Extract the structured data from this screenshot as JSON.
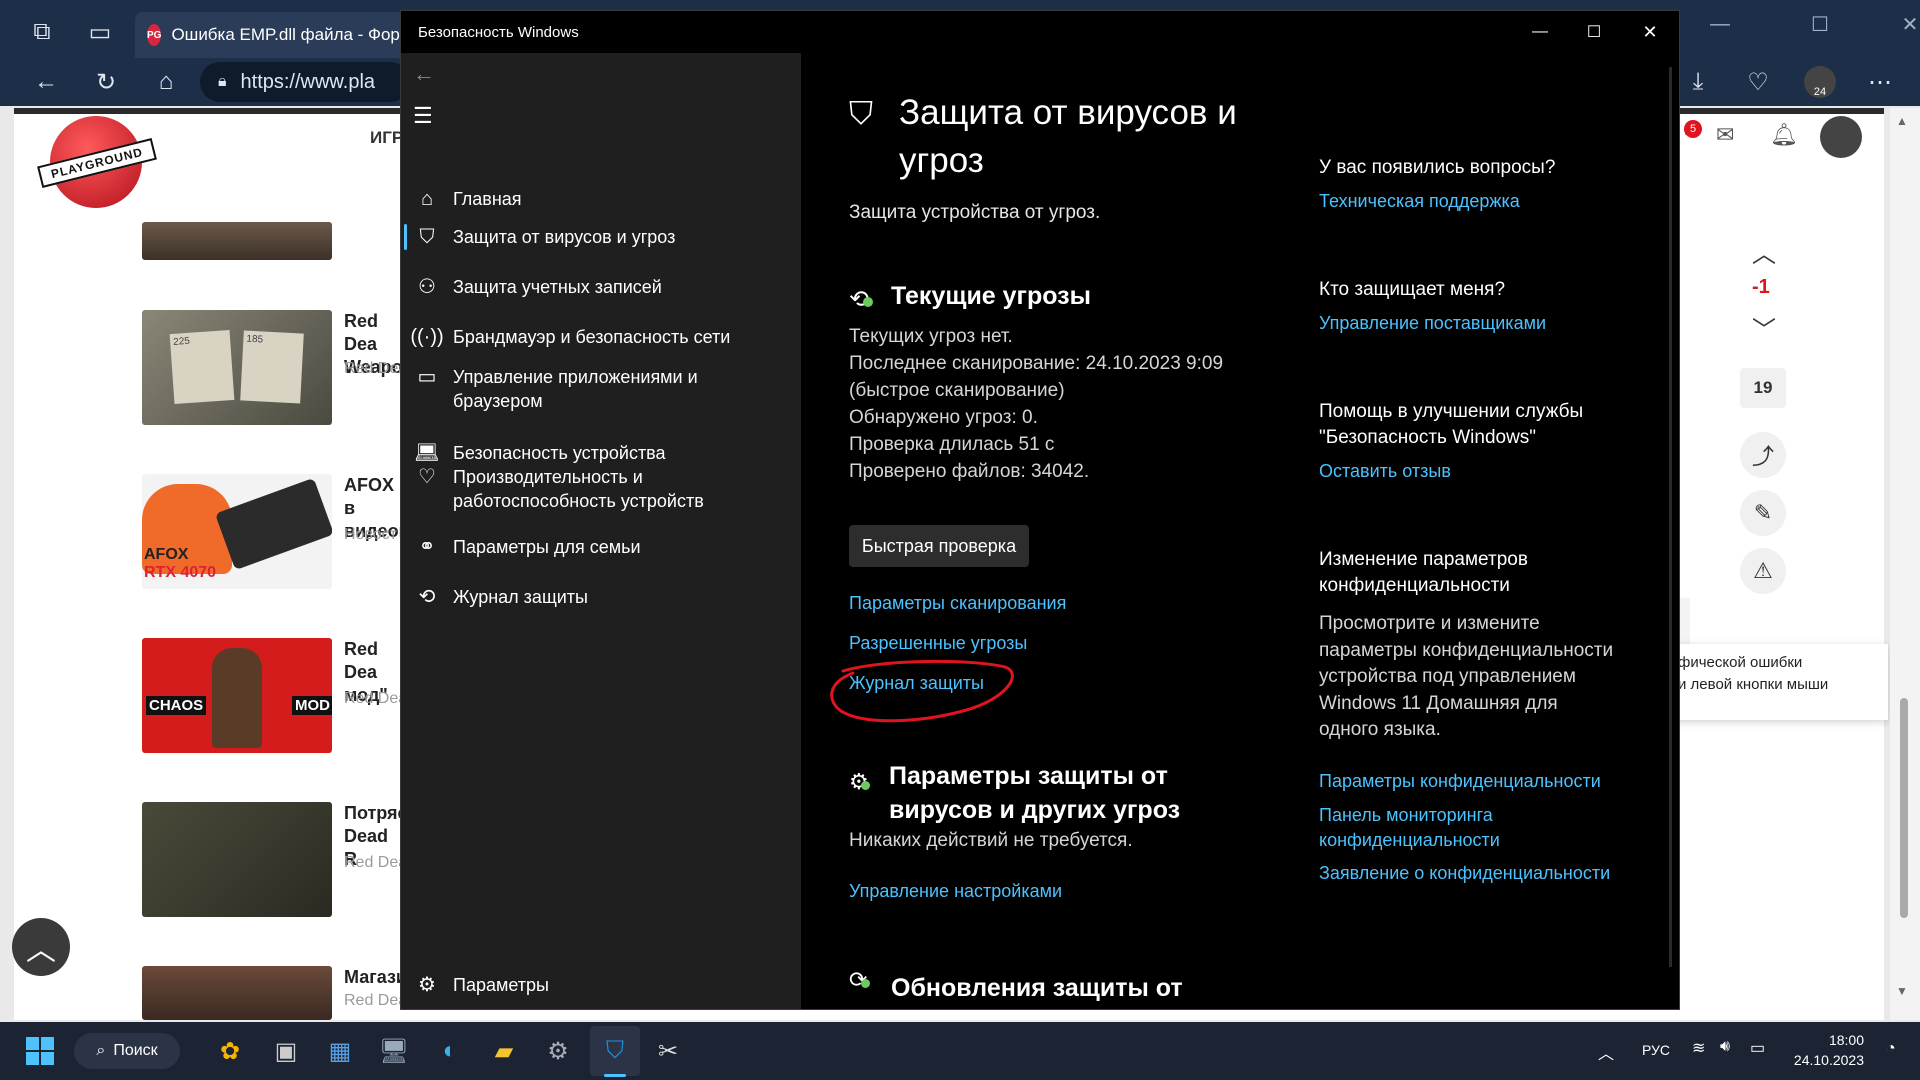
{
  "browser": {
    "tab_title": "Ошибка EMP.dll файла - Фору",
    "tab_favicon": "PG",
    "url_text": "https://www.pla",
    "avatar_badge": "24"
  },
  "site": {
    "logo_text": "PLAYGROUND",
    "nav_partial": "ИГР",
    "notif_count": "5",
    "articles": [
      {
        "title": "Red Dea\nWeapon",
        "meta": "Red Dea"
      },
      {
        "title": "AFOX в\nвидеок",
        "meta": "Новост"
      },
      {
        "title": "Red Dea\nмод\"",
        "meta": "Red Dea"
      },
      {
        "title": "Потряс\nDead R",
        "meta": "Red Dea"
      },
      {
        "title": "Магази",
        "meta": "Red Dea"
      }
    ],
    "thumb_labels": {
      "t2_left": "225",
      "t2_right": "185",
      "t3_brand": "AFOX",
      "t3_model": "RTX 4070",
      "t4_left": "CHAOS",
      "t4_right": "MOD"
    },
    "vote_value": "-1",
    "comments_count": "19",
    "tooltip_text": "фической ошибки\nи левой кнопки мыши"
  },
  "security": {
    "window_title": "Безопасность Windows",
    "nav": [
      {
        "label": "Главная",
        "icon": "home-icon"
      },
      {
        "label": "Защита от вирусов и угроз",
        "icon": "shield-icon"
      },
      {
        "label": "Защита учетных записей",
        "icon": "person-icon"
      },
      {
        "label": "Брандмауэр и безопасность сети",
        "icon": "wifi-icon"
      },
      {
        "label": "Управление приложениями и браузером",
        "icon": "app-browser-icon"
      },
      {
        "label": "Безопасность устройства",
        "icon": "laptop-icon"
      },
      {
        "label": "Производительность и работоспособность устройств",
        "icon": "heart-icon"
      },
      {
        "label": "Параметры для семьи",
        "icon": "family-icon"
      },
      {
        "label": "Журнал защиты",
        "icon": "history-icon"
      }
    ],
    "settings_label": "Параметры",
    "page_title": "Защита от вирусов и угроз",
    "page_subtitle": "Защита устройства от угроз.",
    "current_threats": {
      "heading": "Текущие угрозы",
      "lines": [
        "Текущих угроз нет.",
        "Последнее сканирование: 24.10.2023 9:09",
        "(быстрое сканирование)",
        "Обнаружено угроз: 0.",
        "Проверка длилась 51 с",
        "Проверено файлов: 34042."
      ],
      "quick_scan": "Быстрая проверка",
      "links": [
        "Параметры сканирования",
        "Разрешенные угрозы",
        "Журнал защиты"
      ]
    },
    "protection_settings": {
      "heading": "Параметры защиты от вирусов и других угроз",
      "status": "Никаких действий не требуется.",
      "link": "Управление настройками"
    },
    "updates_heading": "Обновления защиты от",
    "side": {
      "q1": "У вас появились вопросы?",
      "q1_link": "Техническая поддержка",
      "q2": "Кто защищает меня?",
      "q2_link": "Управление поставщиками",
      "q3": "Помощь в улучшении службы \"Безопасность Windows\"",
      "q3_link": "Оставить отзыв",
      "q4": "Изменение параметров конфиденциальности",
      "q4_text": "Просмотрите и измените параметры конфиденциальности устройства под управлением Windows 11 Домашняя для одного языка.",
      "q4_links": [
        "Параметры конфиденциальности",
        "Панель мониторинга конфиденциальности",
        "Заявление о конфиденциальности"
      ]
    }
  },
  "taskbar": {
    "search_label": "Поиск",
    "lang": "РУС",
    "time": "18:00",
    "date": "24.10.2023"
  },
  "colors": {
    "accent": "#4cc2ff",
    "annotation": "#e0141e"
  }
}
